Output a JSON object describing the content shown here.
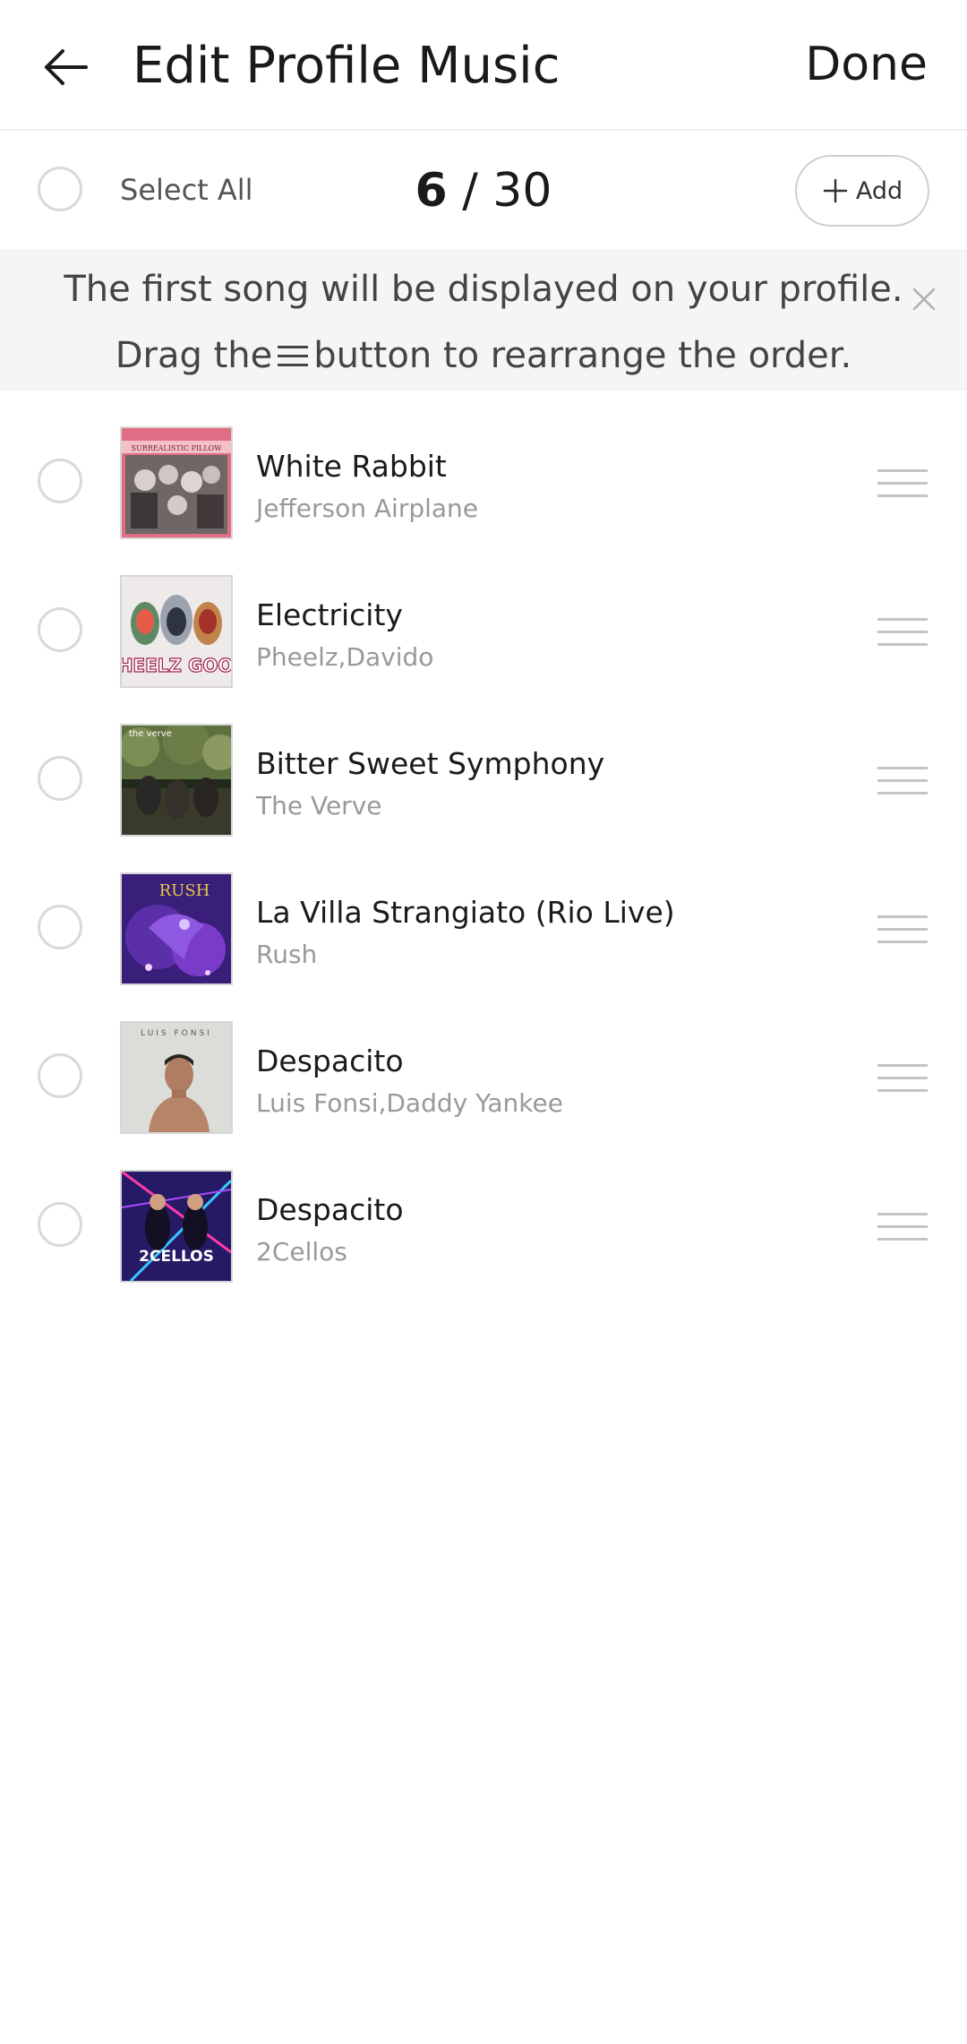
{
  "header": {
    "title": "Edit Profile Music",
    "done_label": "Done",
    "back_icon": "arrow-left-icon"
  },
  "select_bar": {
    "select_all_label": "Select All",
    "count_current": "6",
    "count_separator": " / ",
    "count_max": "30",
    "add_label": "Add",
    "add_icon": "plus-icon"
  },
  "banner": {
    "line1": "The first song will be displayed on your profile.",
    "line2_before": "Drag the",
    "line2_after": "button to rearrange the order.",
    "drag_icon": "hamburger-icon",
    "close_icon": "close-icon"
  },
  "songs": [
    {
      "title": "White Rabbit",
      "artist": "Jefferson Airplane",
      "cover_text": "SURREALISTIC PILLOW",
      "selected": false
    },
    {
      "title": "Electricity",
      "artist": "Pheelz,Davido",
      "cover_text": "PHEELZ GOOD",
      "selected": false
    },
    {
      "title": "Bitter Sweet Symphony",
      "artist": "The Verve",
      "cover_text": "the verve",
      "selected": false
    },
    {
      "title": "La Villa Strangiato (Rio Live)",
      "artist": "Rush",
      "cover_text": "RUSH",
      "selected": false
    },
    {
      "title": "Despacito",
      "artist": "Luis Fonsi,Daddy Yankee",
      "cover_text": "LUIS FONSI",
      "selected": false
    },
    {
      "title": "Despacito",
      "artist": "2Cellos",
      "cover_text": "2CELLOS",
      "selected": false
    }
  ],
  "colors": {
    "banner_bg": "#f5f5f5",
    "radio_border": "#d9d9d9",
    "artist_text": "#999999",
    "handle": "#c4c4c4"
  }
}
